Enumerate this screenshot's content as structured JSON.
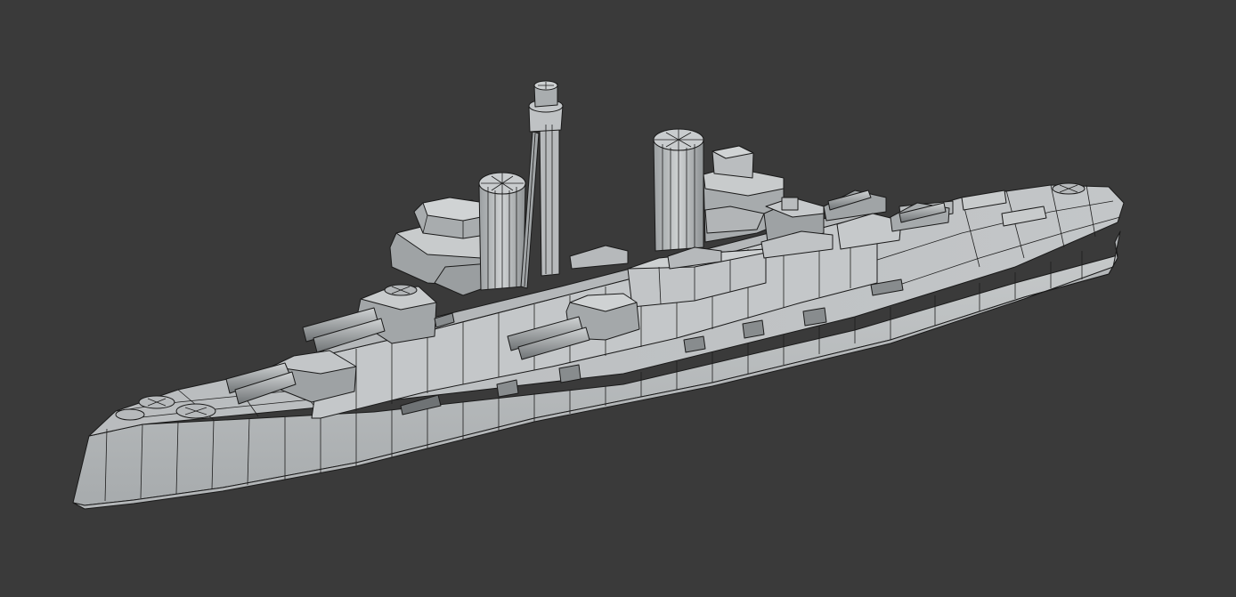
{
  "viewport": {
    "background": "#3a3a3a",
    "model": "battleship-wireframe",
    "shading_light": "#c9cccd",
    "shading_mid": "#a9adaf",
    "shading_dark": "#7f8385",
    "edge_color": "#1a1a1a"
  }
}
